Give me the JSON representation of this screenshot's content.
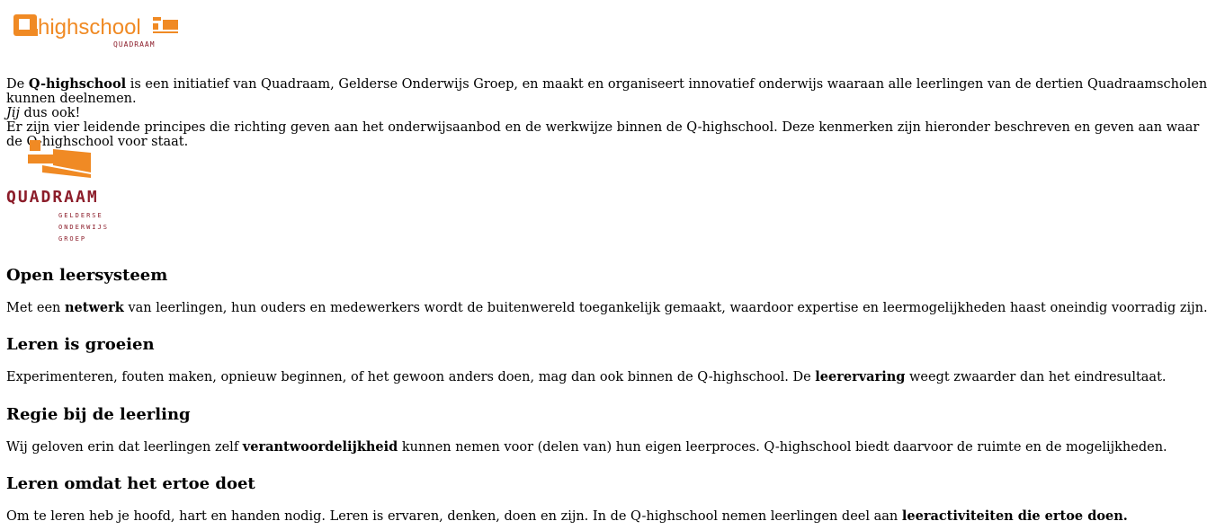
{
  "header": {
    "logo_text": "highschool",
    "logo_subtext": "QUADRAAM",
    "logo_letter": "Q"
  },
  "intro": {
    "line1_pre": "De ",
    "line1_bold": "Q-highschool",
    "line1_post": " is een initiatief van Quadraam, Gelderse Onderwijs Groep, en maakt en organiseert innovatief onderwijs waaraan alle leerlingen van de dertien Quadraamscholen kunnen deelnemen.",
    "line2_italic": "Jij",
    "line2_post": " dus ook!",
    "line3": "Er zijn vier leidende principes die richting geven aan het onderwijsaanbod en de werkwijze binnen de Q-highschool. Deze kenmerken zijn hieronder beschreven en geven aan waar de Q-highschool voor staat."
  },
  "quadraam_logo": {
    "name": "QUADRAAM",
    "line1": "GELDERSE",
    "line2": "ONDERWIJS",
    "line3": "GROEP"
  },
  "principles": [
    {
      "title": "Open leersysteem",
      "pre": "Met een ",
      "bold": "netwerk",
      "post": " van leerlingen, hun ouders en medewerkers wordt de buitenwereld toegankelijk gemaakt, waardoor expertise en leermogelijkheden haast oneindig voorradig zijn."
    },
    {
      "title": "Leren is groeien",
      "pre": "Experimenteren, fouten maken, opnieuw beginnen, of het gewoon anders doen, mag dan ook binnen de Q-highschool. De ",
      "bold": "leerervaring",
      "post": " weegt zwaarder dan het eindresultaat."
    },
    {
      "title": "Regie bij de leerling",
      "pre": "Wij geloven erin dat leerlingen zelf ",
      "bold": "verantwoordelijkheid",
      "post": " kunnen nemen voor (delen van) hun eigen leerproces. Q-highschool biedt daarvoor de ruimte en de mogelijkheden."
    },
    {
      "title": "Leren omdat het ertoe doet",
      "pre": "Om te leren heb je hoofd, hart en handen nodig. Leren is ervaren, denken, doen en zijn. In de Q-highschool nemen leerlingen deel aan ",
      "bold": "leeractiviteiten die ertoe doen.",
      "post": ""
    }
  ],
  "colors": {
    "orange": "#f08a24",
    "dark_red": "#8c1d2a"
  }
}
